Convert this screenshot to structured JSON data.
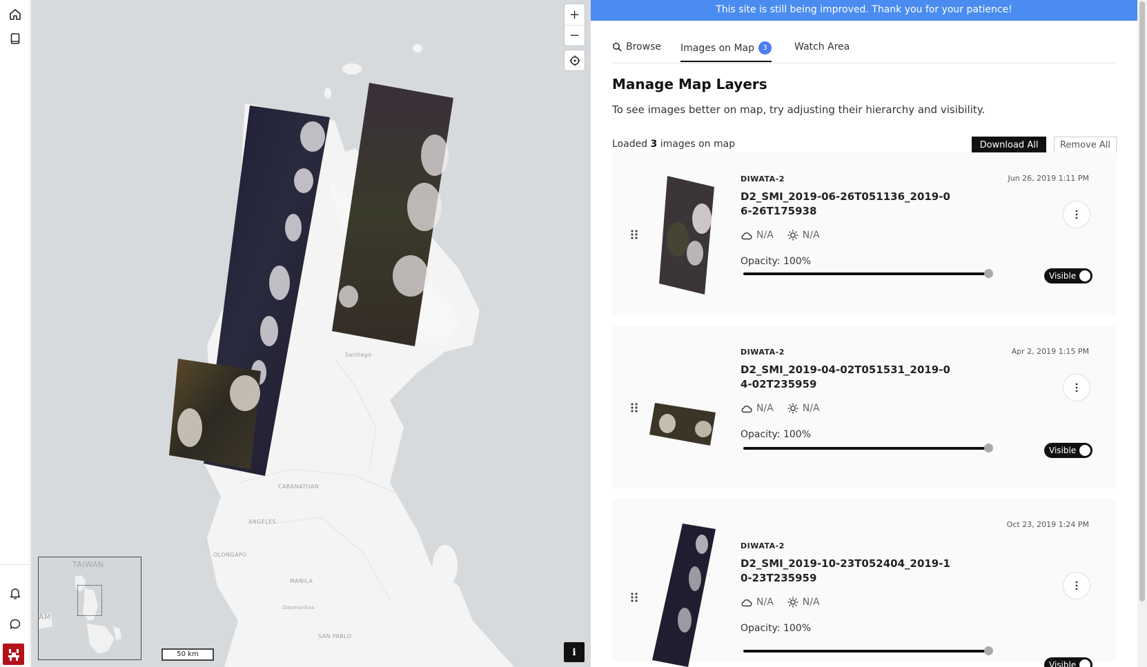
{
  "rail": {
    "top_icons": [
      "home-icon",
      "book-icon"
    ],
    "bottom_icons": [
      "bell-icon",
      "chat-icon"
    ]
  },
  "map": {
    "labels": {
      "santiago": "Santiago",
      "cabanatuan": "CABANATUAN",
      "angeles": "ANGELES",
      "olongapo": "OLONGAPO",
      "manila": "MANILA",
      "dasmarinas": "Dasmariñas",
      "san_pablo": "SAN PABLO"
    },
    "zoom_in": "+",
    "zoom_out": "−",
    "minimap": {
      "taiwan": "TAIWAN",
      "am": "AM"
    },
    "scale": "50 km",
    "info": "i"
  },
  "panel": {
    "banner": "This site is still being improved. Thank you for your patience!",
    "tabs": [
      {
        "label": "Browse"
      },
      {
        "label": "Images on Map",
        "badge": "3"
      },
      {
        "label": "Watch Area"
      }
    ],
    "heading": "Manage Map Layers",
    "subtitle": "To see images better on map, try adjusting their hierarchy and visibility.",
    "loaded_prefix": "Loaded",
    "loaded_count": "3",
    "loaded_suffix": "images on map",
    "download_all": "Download All",
    "remove_all": "Remove All",
    "images": [
      {
        "satellite": "DIWATA-2",
        "date": "Jun 26, 2019 1:11 PM",
        "name": "D2_SMI_2019-06-26T051136_2019-06-26T175938",
        "cloud": "N/A",
        "sun": "N/A",
        "opacity_label": "Opacity: 100%",
        "opacity": 1.0,
        "visible_label": "Visible"
      },
      {
        "satellite": "DIWATA-2",
        "date": "Apr 2, 2019 1:15 PM",
        "name": "D2_SMI_2019-04-02T051531_2019-04-02T235959",
        "cloud": "N/A",
        "sun": "N/A",
        "opacity_label": "Opacity: 100%",
        "opacity": 1.0,
        "visible_label": "Visible"
      },
      {
        "satellite": "DIWATA-2",
        "date": "Oct 23, 2019 1:24 PM",
        "name": "D2_SMI_2019-10-23T052404_2019-10-23T235959",
        "cloud": "N/A",
        "sun": "N/A",
        "opacity_label": "Opacity: 100%",
        "opacity": 1.0,
        "visible_label": "Visible"
      }
    ]
  },
  "colors": {
    "banner": "#4a8cf0",
    "badge": "#4a7ef0",
    "brand": "#b3121b"
  }
}
